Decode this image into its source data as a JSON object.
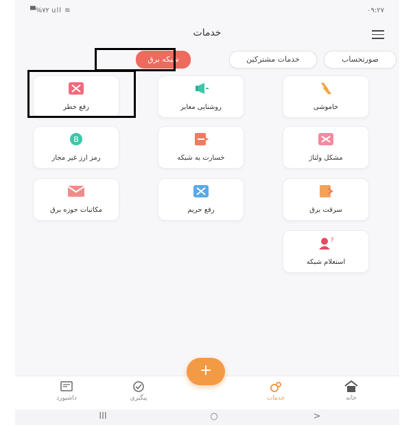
{
  "status_bar": {
    "left": "▀%۷۲ ull ≋",
    "right": "۰۹:۲۷"
  },
  "header": {
    "title": "خدمات"
  },
  "tabs": [
    {
      "label": "صورتحساب",
      "active": false
    },
    {
      "label": "خدمات مشترکین",
      "active": false
    },
    {
      "label": "شبکه برق",
      "active": true
    }
  ],
  "services": [
    {
      "label": "خاموشی",
      "icon": "power-off-icon"
    },
    {
      "label": "روشنایی معابر",
      "icon": "street-light-icon"
    },
    {
      "label": "رفع خطر",
      "icon": "danger-fix-icon"
    },
    {
      "label": "مشکل ولتاژ",
      "icon": "voltage-problem-icon"
    },
    {
      "label": "خسارت به شبکه",
      "icon": "network-damage-icon"
    },
    {
      "label": "رمز ارز غیر مجاز",
      "icon": "crypto-icon"
    },
    {
      "label": "سرقت برق",
      "icon": "electricity-theft-icon"
    },
    {
      "label": "رفع حریم",
      "icon": "boundary-fix-icon"
    },
    {
      "label": "مکاتبات حوزه برق",
      "icon": "mail-icon"
    },
    {
      "label": "استعلام شبکه",
      "icon": "network-inquiry-icon"
    }
  ],
  "bottom_nav": [
    {
      "label": "خانه",
      "icon": "home-icon",
      "active": false
    },
    {
      "label": "خدمات",
      "icon": "services-icon",
      "active": true
    },
    {
      "label": "پیگیری",
      "icon": "tracking-icon",
      "active": false
    },
    {
      "label": "داشبورد",
      "icon": "dashboard-icon",
      "active": false
    }
  ],
  "fab": {
    "label": "+"
  },
  "system_nav": {
    "recent": "III",
    "home": "○",
    "back": ">"
  },
  "colors": {
    "accent": "#f39a45",
    "active_tab": "#ee6a5d",
    "highlight": "#000000"
  }
}
